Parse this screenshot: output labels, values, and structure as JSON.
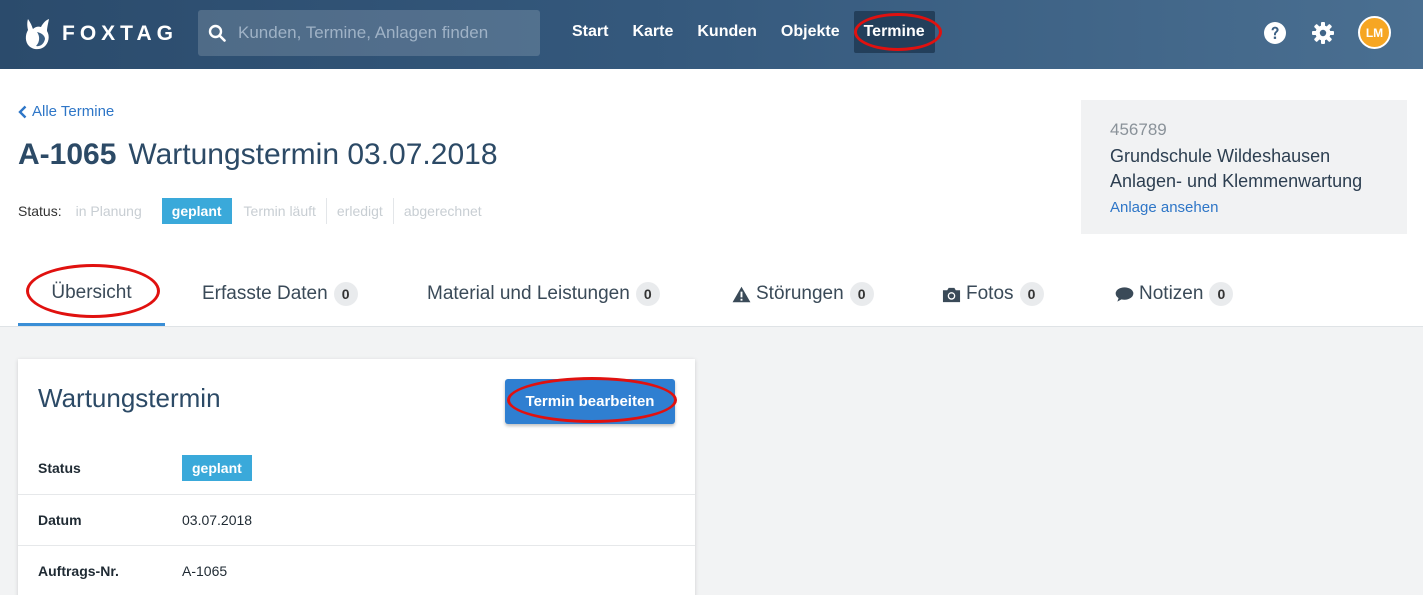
{
  "app": {
    "brand": "FOXTAG",
    "search_placeholder": "Kunden, Termine, Anlagen finden",
    "nav": [
      "Start",
      "Karte",
      "Kunden",
      "Objekte",
      "Termine"
    ],
    "active_nav": "Termine",
    "user_initials": "LM",
    "colors": {
      "header": "#34587c",
      "accent": "#3aa9da",
      "primary_button": "#2f7fd1",
      "link": "#2e76c7",
      "annotation_ring": "#e0110f",
      "avatar": "#f6a623"
    }
  },
  "header": {
    "back_link": "Alle Termine",
    "order_number": "A-1065",
    "title": "Wartungstermin 03.07.2018",
    "status_label": "Status:",
    "status_steps": [
      "in Planung",
      "geplant",
      "Termin läuft",
      "erledigt",
      "abgerechnet"
    ],
    "active_status": "geplant"
  },
  "facility": {
    "id": "456789",
    "name": "Grundschule Wildeshausen",
    "description": "Anlagen- und Klemmenwartung",
    "link": "Anlage ansehen"
  },
  "tabs": [
    {
      "label": "Übersicht",
      "icon": null,
      "count": null,
      "active": true
    },
    {
      "label": "Erfasste Daten",
      "icon": null,
      "count": "0"
    },
    {
      "label": "Material und Leistungen",
      "icon": null,
      "count": "0"
    },
    {
      "label": "Störungen",
      "icon": "warning-icon",
      "count": "0"
    },
    {
      "label": "Fotos",
      "icon": "camera-icon",
      "count": "0"
    },
    {
      "label": "Notizen",
      "icon": "comment-icon",
      "count": "0"
    }
  ],
  "card": {
    "title": "Wartungstermin",
    "edit_button": "Termin bearbeiten",
    "rows": [
      {
        "label": "Status",
        "value": "geplant"
      },
      {
        "label": "Datum",
        "value": "03.07.2018"
      },
      {
        "label": "Auftrags-Nr.",
        "value": "A-1065"
      }
    ]
  }
}
